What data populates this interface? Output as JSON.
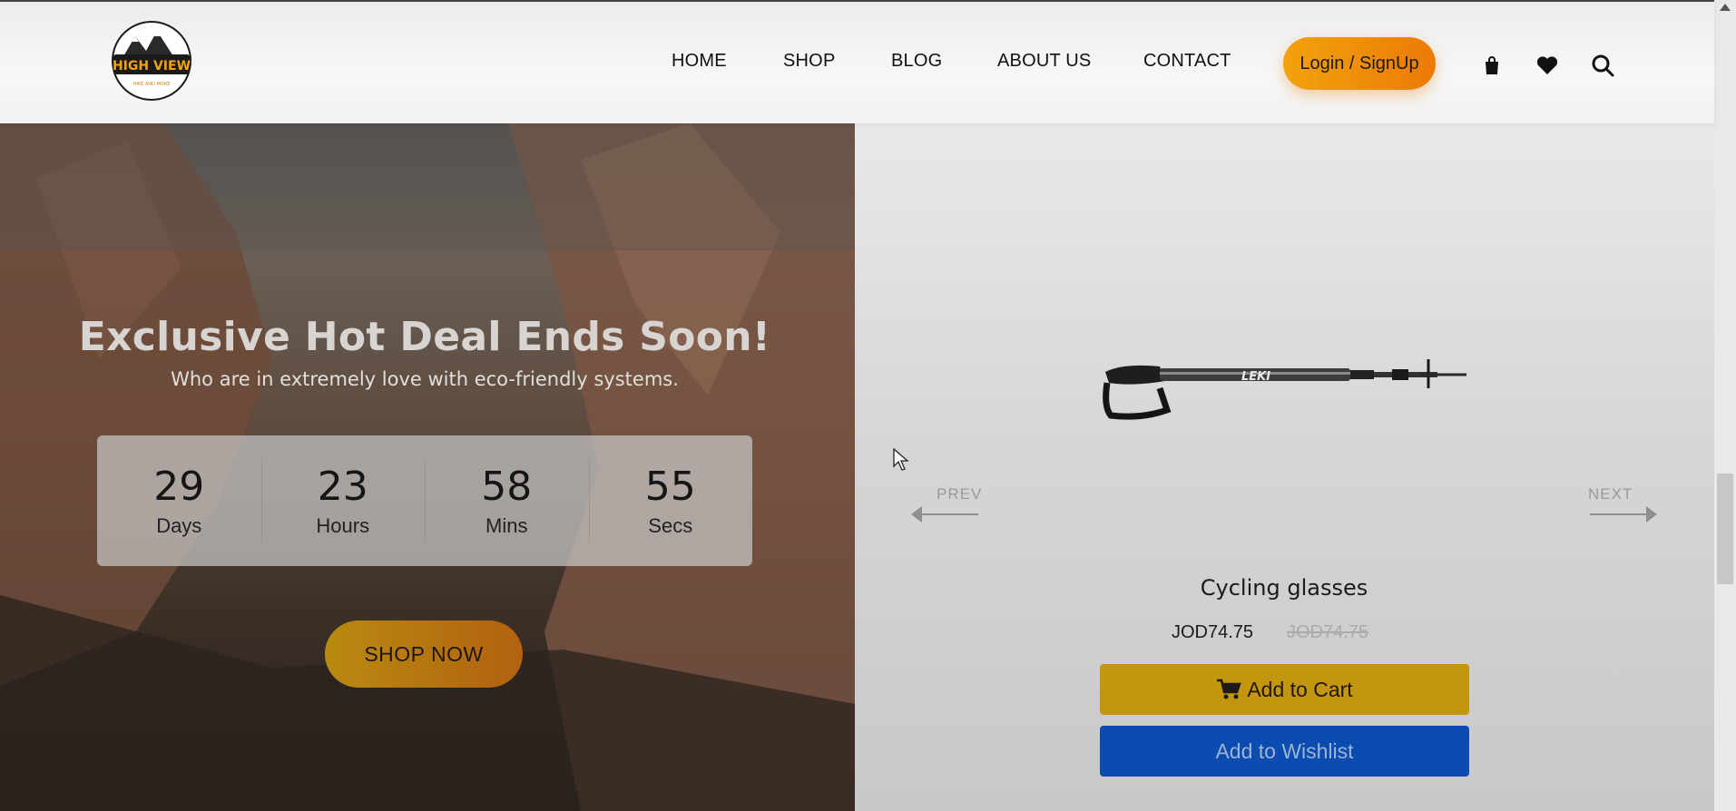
{
  "header": {
    "logo": {
      "text_top": "HIGH VIEW",
      "text_bottom": "HIKE AND MORE"
    },
    "nav": [
      "HOME",
      "SHOP",
      "BLOG",
      "ABOUT US",
      "CONTACT"
    ],
    "login_label": "Login / SignUp",
    "icons": [
      "shopping-bag-icon",
      "heart-icon",
      "search-icon"
    ]
  },
  "hero": {
    "title": "Exclusive Hot Deal Ends Soon!",
    "subtitle": "Who are in extremely love with eco-friendly systems.",
    "countdown": [
      {
        "value": "29",
        "label": "Days"
      },
      {
        "value": "23",
        "label": "Hours"
      },
      {
        "value": "58",
        "label": "Mins"
      },
      {
        "value": "55",
        "label": "Secs"
      }
    ],
    "shop_now_label": "SHOP NOW"
  },
  "carousel": {
    "prev_label": "PREV",
    "next_label": "NEXT",
    "product": {
      "image_brand": "LEKI",
      "name": "Cycling glasses",
      "price": "JOD74.75",
      "old_price": "JOD74.75",
      "add_to_cart_label": "Add to Cart",
      "add_to_wishlist_label": "Add to Wishlist"
    }
  },
  "colors": {
    "accent_orange": "#ec7a06",
    "cart_button": "#c4950e",
    "wishlist_button": "#0a4cb0"
  }
}
